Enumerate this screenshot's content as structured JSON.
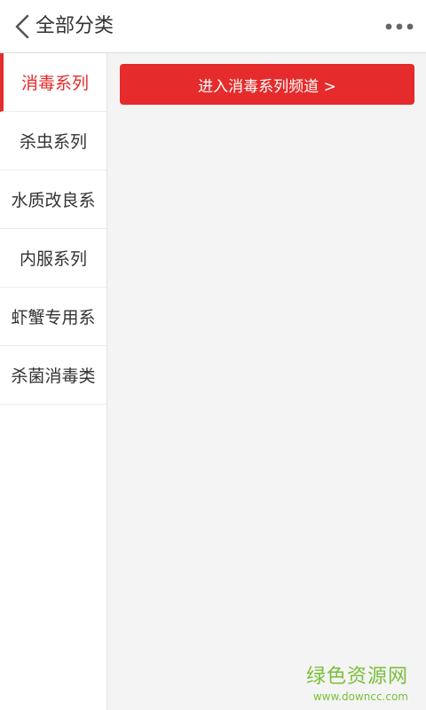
{
  "header": {
    "title": "全部分类"
  },
  "sidebar": {
    "items": [
      {
        "label": "消毒系列",
        "active": true
      },
      {
        "label": "杀虫系列",
        "active": false
      },
      {
        "label": "水质改良系",
        "active": false
      },
      {
        "label": "内服系列",
        "active": false
      },
      {
        "label": "虾蟹专用系",
        "active": false
      },
      {
        "label": "杀菌消毒类",
        "active": false
      }
    ]
  },
  "main": {
    "channel_button_label": "进入消毒系列频道 >"
  },
  "watermark": {
    "main": "绿色资源网",
    "sub": "www.downcc.com"
  },
  "colors": {
    "accent": "#e52b2b",
    "watermark": "#7bbf3a"
  },
  "icons": {
    "back": "chevron-left-icon",
    "more": "more-horizontal-icon"
  }
}
